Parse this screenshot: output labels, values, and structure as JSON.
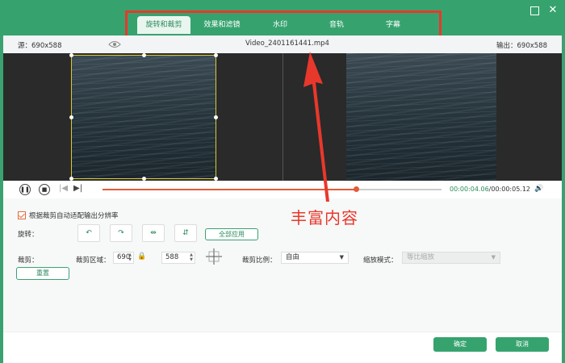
{
  "tabs": [
    {
      "label": "旋转和裁剪",
      "active": true
    },
    {
      "label": "效果和滤镜",
      "active": false
    },
    {
      "label": "水印",
      "active": false
    },
    {
      "label": "音轨",
      "active": false
    },
    {
      "label": "字幕",
      "active": false
    }
  ],
  "info": {
    "source": "源：690x588",
    "filename": "Video_2401161441.mp4",
    "output": "输出：690x588"
  },
  "player": {
    "time_current": "00:00:04.06",
    "time_total": "/00:00:05.12",
    "progress": 0.79
  },
  "options": {
    "auto_fit_label": "根据裁剪自动适配输出分辨率",
    "auto_fit_checked": true,
    "rotate_label": "旋转：",
    "apply_all_label": "全部应用",
    "crop_label": "裁剪：",
    "crop_area_label": "裁剪区域：",
    "crop_width": "690",
    "crop_height": "588",
    "ratio_label": "裁剪比例：",
    "ratio_value": "自由",
    "zoom_mode_label": "缩放模式：",
    "zoom_mode_value": "等比缩放",
    "reset_label": "重置"
  },
  "annotation": "丰富内容",
  "footer": {
    "ok_label": "确定",
    "cancel_label": "取消"
  },
  "colors": {
    "brand_green": "#36a36f",
    "highlight_red": "#e8382b",
    "timeline_orange": "#e35b38"
  }
}
